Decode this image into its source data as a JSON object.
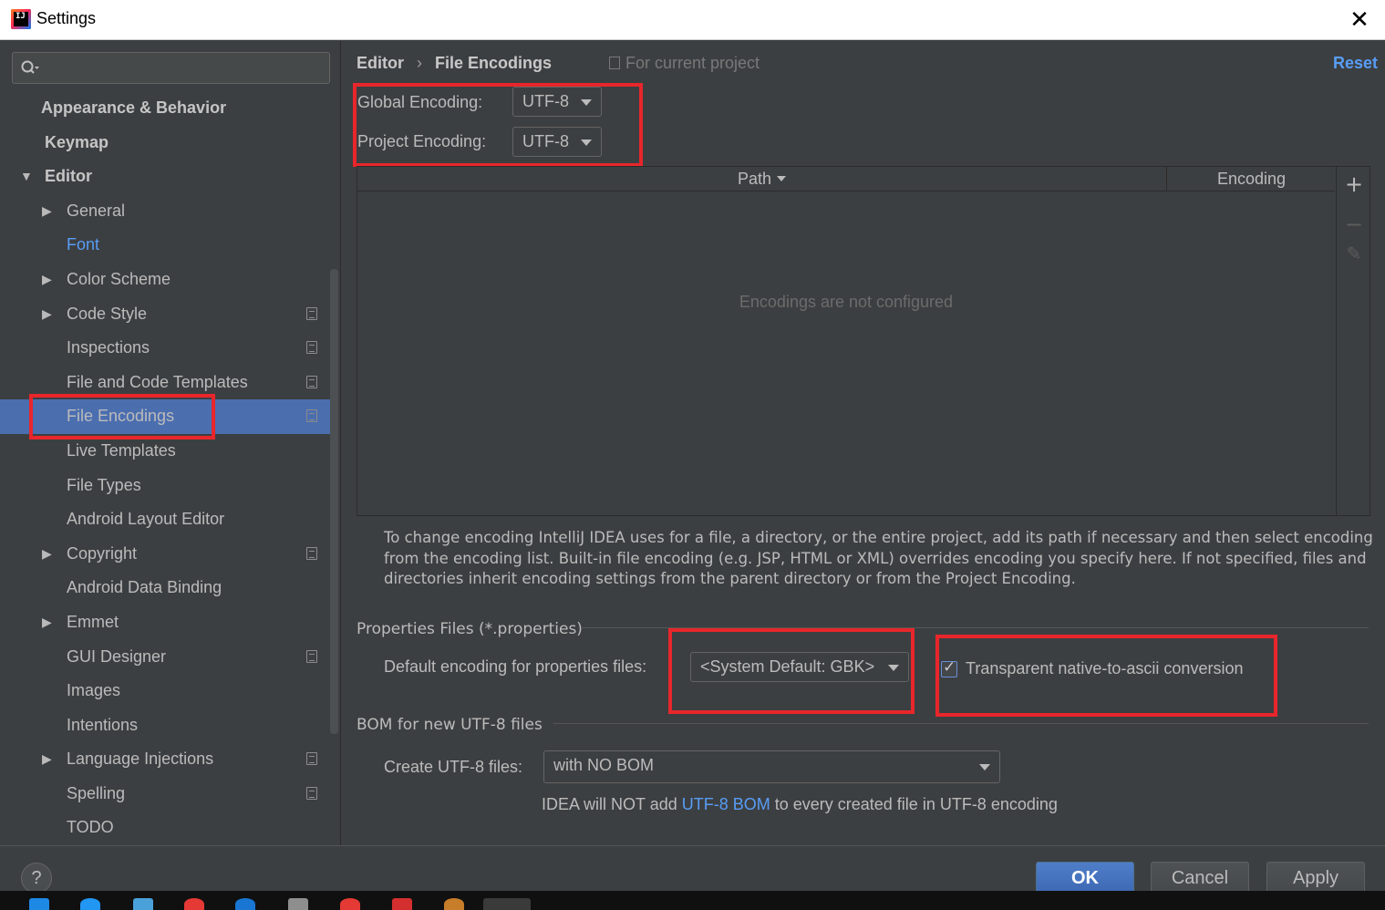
{
  "window": {
    "title": "Settings"
  },
  "sidebar": {
    "search_placeholder": "",
    "items": [
      {
        "label": "Appearance & Behavior",
        "level": 0,
        "bold": true,
        "arrow": ""
      },
      {
        "label": "Keymap",
        "level": 0,
        "bold": true,
        "arrow": ""
      },
      {
        "label": "Editor",
        "level": 0,
        "bold": true,
        "arrow": "▼"
      },
      {
        "label": "General",
        "level": 1,
        "arrow": "▶"
      },
      {
        "label": "Font",
        "level": 1,
        "arrow": "",
        "link": true
      },
      {
        "label": "Color Scheme",
        "level": 1,
        "arrow": "▶"
      },
      {
        "label": "Code Style",
        "level": 1,
        "arrow": "▶",
        "project": true
      },
      {
        "label": "Inspections",
        "level": 1,
        "arrow": "",
        "project": true
      },
      {
        "label": "File and Code Templates",
        "level": 1,
        "arrow": "",
        "project": true
      },
      {
        "label": "File Encodings",
        "level": 1,
        "arrow": "",
        "project": true,
        "selected": true
      },
      {
        "label": "Live Templates",
        "level": 1,
        "arrow": ""
      },
      {
        "label": "File Types",
        "level": 1,
        "arrow": ""
      },
      {
        "label": "Android Layout Editor",
        "level": 1,
        "arrow": ""
      },
      {
        "label": "Copyright",
        "level": 1,
        "arrow": "▶",
        "project": true
      },
      {
        "label": "Android Data Binding",
        "level": 1,
        "arrow": ""
      },
      {
        "label": "Emmet",
        "level": 1,
        "arrow": "▶"
      },
      {
        "label": "GUI Designer",
        "level": 1,
        "arrow": "",
        "project": true
      },
      {
        "label": "Images",
        "level": 1,
        "arrow": ""
      },
      {
        "label": "Intentions",
        "level": 1,
        "arrow": ""
      },
      {
        "label": "Language Injections",
        "level": 1,
        "arrow": "▶",
        "project": true
      },
      {
        "label": "Spelling",
        "level": 1,
        "arrow": "",
        "project": true
      },
      {
        "label": "TODO",
        "level": 1,
        "arrow": ""
      }
    ]
  },
  "main": {
    "breadcrumb": {
      "parent": "Editor",
      "separator": "›",
      "current": "File Encodings"
    },
    "for_project": "For current project",
    "reset": "Reset",
    "global_encoding": {
      "label": "Global Encoding:",
      "value": "UTF-8"
    },
    "project_encoding": {
      "label": "Project Encoding:",
      "value": "UTF-8"
    },
    "table": {
      "columns": [
        "Path",
        "Encoding"
      ],
      "empty_text": "Encodings are not configured",
      "add": "+",
      "remove": "−",
      "edit": "✎"
    },
    "help_text": "To change encoding IntelliJ IDEA uses for a file, a directory, or the entire project, add its path if necessary and then select encoding from the encoding list. Built-in file encoding (e.g. JSP, HTML or XML) overrides encoding you specify here. If not specified, files and directories inherit encoding settings from the parent directory or from the Project Encoding.",
    "properties": {
      "section_title": "Properties Files (*.properties)",
      "default_label": "Default encoding for properties files:",
      "default_value": "<System Default: GBK>",
      "transparent_label": "Transparent native-to-ascii conversion",
      "transparent_checked": true
    },
    "bom": {
      "section_title": "BOM for new UTF-8 files",
      "create_label": "Create UTF-8 files:",
      "create_value": "with NO BOM",
      "info_prefix": "IDEA will NOT add ",
      "info_link": "UTF-8 BOM",
      "info_suffix": " to every created file in UTF-8 encoding"
    }
  },
  "buttons": {
    "help": "?",
    "ok": "OK",
    "cancel": "Cancel",
    "apply": "Apply"
  },
  "colors": {
    "accent": "#589df6",
    "selection": "#4b6eaf",
    "highlight": "#e8262b",
    "background": "#3c3f41"
  }
}
